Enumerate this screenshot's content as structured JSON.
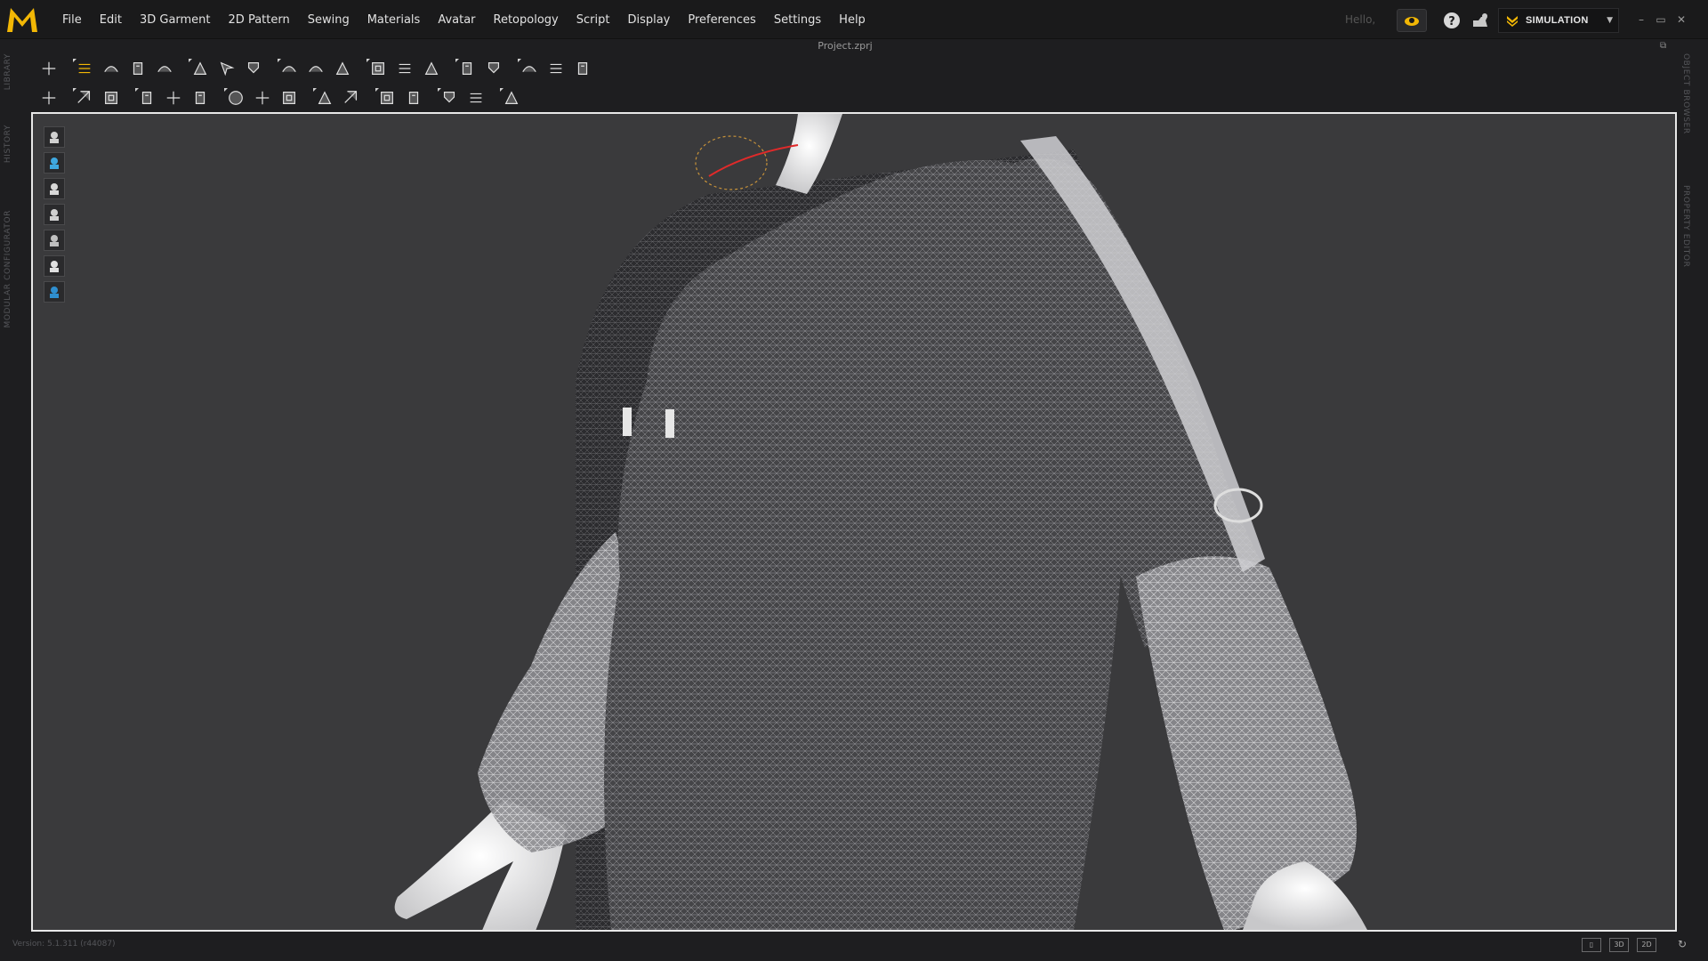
{
  "app": {
    "project_title": "Project.zprj",
    "hello_text": "Hello,",
    "mode_label": "SIMULATION",
    "version_text": "Version: 5.1.311 (r44087)"
  },
  "menu": [
    "File",
    "Edit",
    "3D Garment",
    "2D Pattern",
    "Sewing",
    "Materials",
    "Avatar",
    "Retopology",
    "Script",
    "Display",
    "Preferences",
    "Settings",
    "Help"
  ],
  "side_tabs_left": [
    "LIBRARY",
    "HISTORY",
    "MODULAR CONFIGURATOR"
  ],
  "side_tabs_right": [
    "OBJECT BROWSER",
    "PROPERTY EDITOR"
  ],
  "toolbar1_icons": [
    "select-move-icon",
    "transform-pattern-icon",
    "edit-pattern-icon",
    "edit-curvature-icon",
    "fold-arrangement-icon",
    "arrange-icon",
    "reset-arrangement-icon",
    "reset-2d-icon",
    "segment-sewing-icon",
    "free-sewing-icon",
    "check-sewing-icon",
    "tack-icon",
    "tack-on-avatar-icon",
    "pin-icon",
    "select-mesh-icon",
    "fold-icon",
    "strengthen-icon",
    "topstitch-icon",
    "puckering-icon"
  ],
  "toolbar2_icons": [
    "avatar-pose-icon",
    "select-sewing-icon",
    "edit-sewing-icon",
    "tape-icon",
    "fold-line-icon",
    "shirring-icon",
    "button-icon",
    "buttonhole-icon",
    "zip-icon",
    "gauge-icon",
    "fabric-icon",
    "trim-icon",
    "measure-icon",
    "grain-line-icon",
    "pin-tool-icon",
    "fit-map-icon"
  ],
  "side_tools": [
    "garment-view-icon",
    "fabric-sphere-icon",
    "avatar-view-icon",
    "layers-icon",
    "texture-icon",
    "avatar-silhouette-icon",
    "globe-icon"
  ],
  "view_buttons": [
    "single-view",
    "3D",
    "2D"
  ],
  "colors": {
    "accent": "#f2b705",
    "viewport_bg": "#3a3a3c",
    "frame": "#e8e8e8"
  }
}
